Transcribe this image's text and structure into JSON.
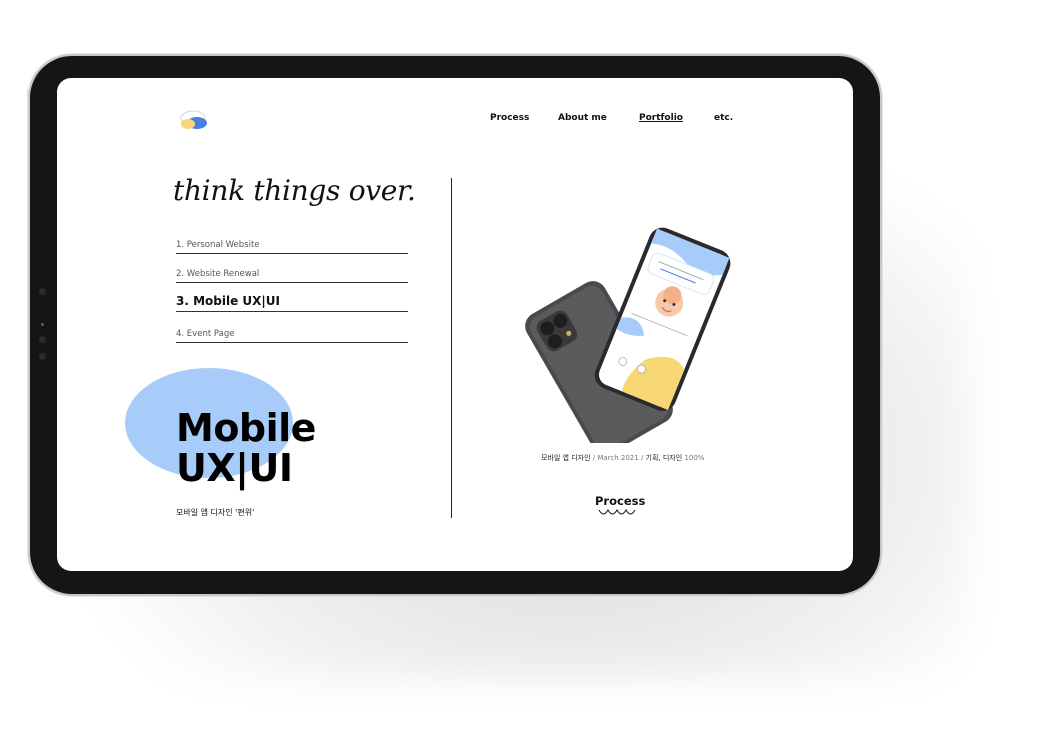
{
  "nav": {
    "items": [
      {
        "label": "Process",
        "active": false
      },
      {
        "label": "About me",
        "active": false
      },
      {
        "label": "Portfolio",
        "active": true
      },
      {
        "label": "etc.",
        "active": false
      }
    ]
  },
  "tagline": "think things over.",
  "portfolio_list": [
    {
      "label": "1. Personal Website",
      "active": false
    },
    {
      "label": "2. Website Renewal",
      "active": false
    },
    {
      "label": "3. Mobile UX|UI",
      "active": true
    },
    {
      "label": "4. Event Page",
      "active": false
    }
  ],
  "hero": {
    "title_line1": "Mobile",
    "title_line2": "UX|UI",
    "subtitle": "모바일 앱 디자인 '편위'"
  },
  "caption": {
    "part1": "모바일 앱 디자인",
    "part2": " / March 2021 / ",
    "part3": "기획, 디자인",
    "part4": " 100%"
  },
  "process_link": "Process",
  "colors": {
    "accent_blue": "#a8ccf9",
    "accent_yellow": "#f7d774",
    "device_frame": "#151515"
  }
}
